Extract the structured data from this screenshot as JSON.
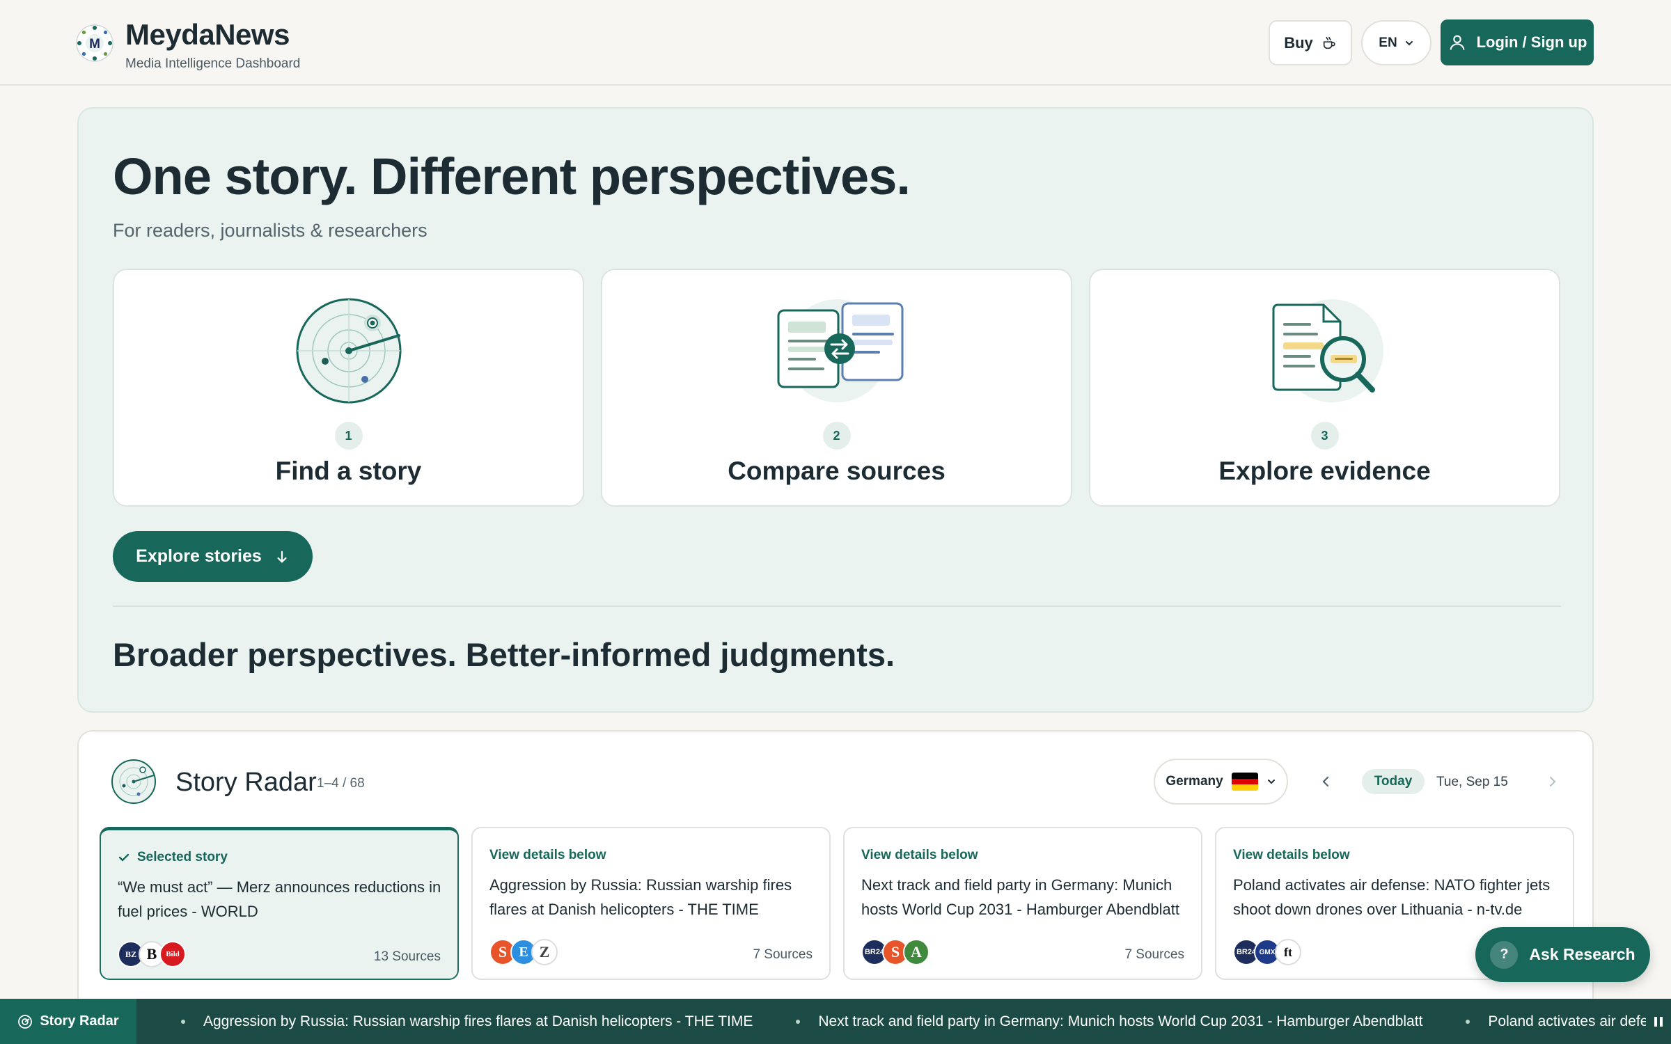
{
  "header": {
    "brand": "MeydaNews",
    "subtitle": "Media Intelligence Dashboard",
    "buy_label": "Buy",
    "lang_label": "EN",
    "login_label": "Login / Sign up"
  },
  "hero": {
    "title": "One story. Different perspectives.",
    "subtitle": "For readers, journalists & researchers",
    "steps": [
      {
        "num": "1",
        "title": "Find a story",
        "icon": "radar-icon"
      },
      {
        "num": "2",
        "title": "Compare sources",
        "icon": "compare-documents-icon"
      },
      {
        "num": "3",
        "title": "Explore evidence",
        "icon": "magnifier-document-icon"
      }
    ],
    "explore_label": "Explore stories",
    "tagline": "Broader perspectives. Better-informed judgments."
  },
  "radar": {
    "title": "Story Radar",
    "count": "1–4 / 68",
    "country": "Germany",
    "today_label": "Today",
    "date": "Tue, Sep 15",
    "stories": [
      {
        "tag": "Selected story",
        "title": "“We must act” — Merz announces reductions in fuel prices - WORLD",
        "sources": "13 Sources",
        "selected": true
      },
      {
        "tag": "View details below",
        "title": "Aggression by Russia: Russian warship fires flares at Danish helicopters - THE TIME",
        "sources": "7 Sources"
      },
      {
        "tag": "View details below",
        "title": "Next track and field party in Germany: Munich hosts World Cup 2031 - Hamburger Abendblatt",
        "sources": "7 Sources"
      },
      {
        "tag": "View details below",
        "title": "Poland activates air defense: NATO fighter jets shoot down drones over Lithuania - n-tv.de",
        "sources": ""
      }
    ],
    "logos": [
      [
        "BZ",
        "B",
        "Bild"
      ],
      [
        "S",
        "E",
        "Z"
      ],
      [
        "BR24",
        "S",
        "A"
      ],
      [
        "BR24",
        "GMX",
        "ft"
      ]
    ]
  },
  "ask_label": "Ask Research",
  "ticker": {
    "label": "Story Radar",
    "items": [
      "Aggression by Russia: Russian warship fires flares at Danish helicopters - THE TIME",
      "Next track and field party in Germany: Munich hosts World Cup 2031 - Hamburger Abendblatt",
      "Poland activates air defense: NATO fighter jets shoot down drones over Lithuania - n-tv.de"
    ]
  },
  "colors": {
    "accent": "#17675a",
    "hero_bg": "#eaf3f0",
    "page_bg": "#f7f6f2",
    "ticker_bg": "#1c4a45"
  }
}
